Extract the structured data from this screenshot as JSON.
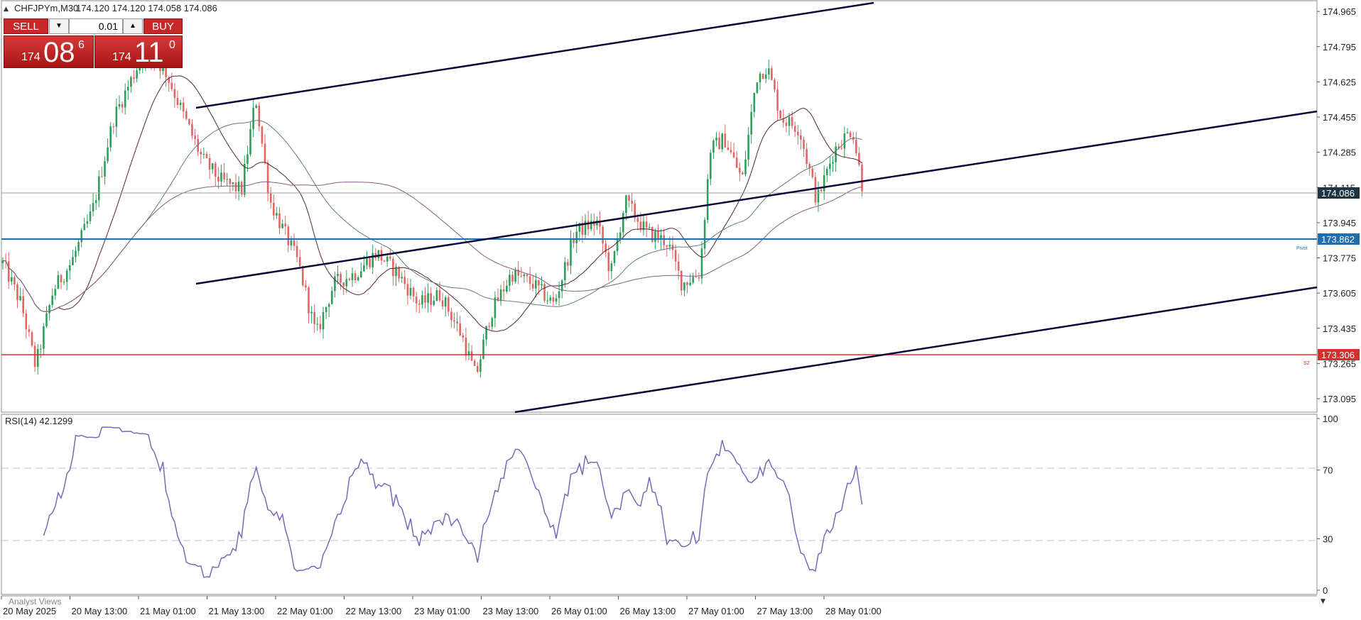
{
  "header": {
    "symbol": "CHFJPYm,M30",
    "ohlc": "174.120 174.120 174.058 174.086"
  },
  "trade_panel": {
    "sell_label": "SELL",
    "buy_label": "BUY",
    "lot_value": "0.01",
    "sell_price": {
      "prefix": "174",
      "big": "08",
      "sup": "6"
    },
    "buy_price": {
      "prefix": "174",
      "big": "11",
      "sup": "0"
    }
  },
  "price_axis": {
    "ticks": [
      "174.965",
      "174.795",
      "174.625",
      "174.455",
      "174.285",
      "174.115",
      "173.945",
      "173.775",
      "173.605",
      "173.435",
      "173.265",
      "173.095"
    ],
    "current_price_label": "174.086",
    "pivot_price_label": "173.862",
    "s2_price_label": "173.306"
  },
  "level_labels": {
    "pivot": "Pivot",
    "s2": "S2"
  },
  "indicator": {
    "title": "RSI(14) 42.1299",
    "ticks": [
      "100",
      "70",
      "30",
      "0"
    ]
  },
  "time_axis": {
    "labels": [
      "20 May 2025",
      "20 May 13:00",
      "21 May 01:00",
      "21 May 13:00",
      "22 May 01:00",
      "22 May 13:00",
      "23 May 01:00",
      "23 May 13:00",
      "26 May 01:00",
      "26 May 13:00",
      "27 May 01:00",
      "27 May 13:00",
      "28 May 01:00"
    ]
  },
  "footer": {
    "analyst_views": "Analyst Views"
  },
  "colors": {
    "bull": "#2e9e5b",
    "bear": "#e06666",
    "pivot_line": "#1f6fb0",
    "s2_line": "#d32f2f",
    "current_price_bg": "#1f3340",
    "rsi_line": "#7b68b8",
    "channel": "#0a0a3a"
  },
  "chart_data": {
    "type": "line",
    "x": [
      "20 May 2025",
      "20 May 13:00",
      "21 May 01:00",
      "21 May 13:00",
      "22 May 01:00",
      "22 May 13:00",
      "23 May 01:00",
      "23 May 13:00",
      "26 May 01:00",
      "26 May 13:00",
      "27 May 01:00",
      "27 May 13:00",
      "28 May 01:00"
    ],
    "series": [
      {
        "name": "CHFJPYm,M30",
        "values": [
          173.7,
          173.7,
          174.75,
          174.1,
          173.8,
          173.9,
          173.6,
          173.3,
          173.9,
          173.95,
          173.65,
          174.65,
          174.35
        ]
      }
    ],
    "levels": {
      "pivot": 173.862,
      "s2": 173.306,
      "current": 174.086
    },
    "ylim": [
      173.03,
      175.01
    ],
    "rsi": {
      "value": 42.1299,
      "levels": [
        70,
        30
      ],
      "ylim": [
        0,
        100
      ]
    }
  }
}
